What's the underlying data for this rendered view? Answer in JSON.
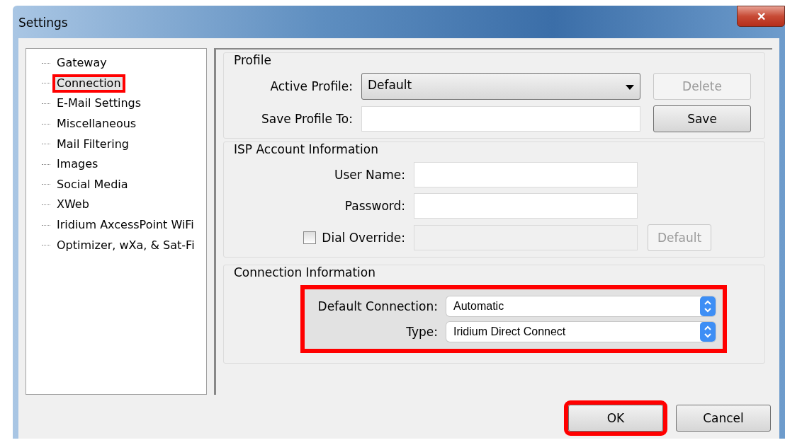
{
  "window": {
    "title": "Settings",
    "close_label": "✕"
  },
  "sidebar": {
    "items": [
      {
        "label": "Gateway",
        "selected": false,
        "highlighted": false
      },
      {
        "label": "Connection",
        "selected": true,
        "highlighted": true
      },
      {
        "label": "E-Mail Settings",
        "selected": false,
        "highlighted": false
      },
      {
        "label": "Miscellaneous",
        "selected": false,
        "highlighted": false
      },
      {
        "label": "Mail Filtering",
        "selected": false,
        "highlighted": false
      },
      {
        "label": "Images",
        "selected": false,
        "highlighted": false
      },
      {
        "label": "Social Media",
        "selected": false,
        "highlighted": false
      },
      {
        "label": "XWeb",
        "selected": false,
        "highlighted": false
      },
      {
        "label": "Iridium AxcessPoint WiFi",
        "selected": false,
        "highlighted": false
      },
      {
        "label": "Optimizer, wXa, & Sat-Fi",
        "selected": false,
        "highlighted": false
      }
    ]
  },
  "profile": {
    "title": "Profile",
    "active_label": "Active Profile:",
    "active_value": "Default",
    "delete": {
      "label": "Delete",
      "disabled": true
    },
    "save_label": "Save Profile To:",
    "save": {
      "label": "Save",
      "disabled": false
    }
  },
  "isp": {
    "title": "ISP Account Information",
    "username_label": "User Name:",
    "password_label": "Password:",
    "dial_override": {
      "label": "Dial Override:",
      "checked": false
    },
    "default_button": {
      "label": "Default",
      "disabled": true
    }
  },
  "connection": {
    "title": "Connection Information",
    "highlighted": true,
    "default_label": "Default Connection:",
    "default_value": "Automatic",
    "type_label": "Type:",
    "type_value": "Iridium Direct Connect"
  },
  "buttons": [
    {
      "label": "OK",
      "highlighted": true
    },
    {
      "label": "Cancel",
      "highlighted": false
    }
  ]
}
